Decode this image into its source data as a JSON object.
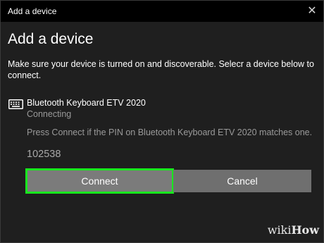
{
  "window": {
    "title": "Add a device",
    "close_glyph": "✕"
  },
  "heading": "Add a device",
  "description": "Make sure your device is turned on and discoverable. Selecr a device below to connect.",
  "device": {
    "icon": "keyboard-icon",
    "name": "Bluetooth Keyboard ETV 2020",
    "status": "Connecting"
  },
  "pin": {
    "instruction": "Press Connect if the PIN on Bluetooth Keyboard ETV 2020 matches one.",
    "code": "102538"
  },
  "buttons": {
    "connect_label": "Connect",
    "cancel_label": "Cancel"
  },
  "watermark": {
    "wiki": "wiki",
    "how": "How"
  },
  "colors": {
    "highlight": "#18e81e",
    "button": "#7b7b7b",
    "background": "#1f1f1f"
  }
}
